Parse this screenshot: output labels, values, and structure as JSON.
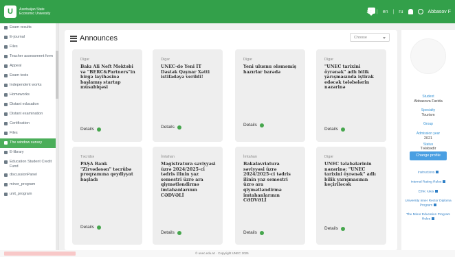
{
  "header": {
    "logo_mark": "U",
    "logo_line1": "Azerbaijan State",
    "logo_line2": "Economic University",
    "lang_1": "az",
    "lang_2": "en",
    "lang_3": "ru",
    "user_short": "Abbasov F"
  },
  "sidebar": {
    "items": [
      {
        "label": "Exam results",
        "icon": "exam-icon"
      },
      {
        "label": "E-journal",
        "icon": "journal-icon"
      },
      {
        "label": "Files",
        "icon": "files-icon"
      },
      {
        "label": "Teacher assessment form",
        "icon": "assessment-icon"
      },
      {
        "label": "Appeal",
        "icon": "appeal-icon"
      },
      {
        "label": "Exam tests",
        "icon": "tests-icon"
      },
      {
        "label": "Independent works",
        "icon": "works-icon"
      },
      {
        "label": "Homeworks",
        "icon": "homework-icon"
      },
      {
        "label": "Distant education",
        "icon": "distant-icon"
      },
      {
        "label": "Distant examination",
        "icon": "examination-icon"
      },
      {
        "label": "Certification",
        "icon": "certificate-icon"
      },
      {
        "label": "Files",
        "icon": "files-icon"
      },
      {
        "label": "The window survey",
        "icon": "survey-icon"
      },
      {
        "label": "E-library",
        "icon": "library-icon"
      },
      {
        "label": "Education Student Credit Fund",
        "icon": "fund-icon"
      },
      {
        "label": "discussionPanel",
        "icon": "discussion-icon"
      },
      {
        "label": "minor_program",
        "icon": "program-icon"
      },
      {
        "label": "unit_program",
        "icon": "unit-icon"
      }
    ],
    "active_index": 12
  },
  "main": {
    "title": "Announces",
    "filter_placeholder": "Choose"
  },
  "cards": [
    {
      "category": "Digər",
      "text": "Bakı Ali Neft Məktəbi və \"BERC&Partners\"in birgə layihəsinə başlamış startap müsabiqəsi",
      "details": "Details"
    },
    {
      "category": "Digər",
      "text": "UNEC-də Yeni İT Dəstək Qaynar Xətti istifadəyə verildi!",
      "details": "Details"
    },
    {
      "category": "Digər",
      "text": "Yeni ulusnu ələməmiş hazırlar barədə",
      "details": "Details"
    },
    {
      "category": "Digər",
      "text": "\"UNEC tarixini öyrənək\" adlı bilik yarışmasında iştirak edəcək tələbələrin nəzərinə",
      "details": "Details"
    },
    {
      "category": "Təcrübə",
      "text": "PAŞA Bank \"Zirvədəsən\" təcrübə proqramına qeydiyyat başladı",
      "details": "Details"
    },
    {
      "category": "İmtahan",
      "text": "Magistratura səviyyəsi üzrə 2024/2025-ci tədris ilinin yaz semestri üzrə ara qiymətləndirmə imtahanlarının CƏDVƏLİ",
      "details": "Details"
    },
    {
      "category": "İmtahan",
      "text": "Bakalavriatura səviyyəsi üzrə 2024/2025-ci tədris ilinin yaz semestri üzrə ara qiymətləndirmə imtahanlarının CƏDVƏLİ",
      "details": "Details"
    },
    {
      "category": "Digər",
      "text": "UNEC tələbələrinin nəzərinə: \"UNEC tarixini öyrənək\" adlı bilik yarışmasının keçiriləcək",
      "details": "Details"
    }
  ],
  "profile": {
    "student_label": "Student",
    "student_name": "Abbasova Farida",
    "specialty_label": "Specialty",
    "specialty_value": "Tourism",
    "group_label": "Group",
    "admission_label": "Admission year",
    "admission_value": "2021",
    "status_label": "Status",
    "status_value": "Tələbədir",
    "change_profile": "Change profile",
    "links": [
      "Instructions",
      "Internal Rating Rules",
      "Ethic rules",
      "University inner Rector Diploma Program",
      "The Minor Education Program Rules"
    ]
  },
  "footer": {
    "text": "© unec.edu.az · Copyright UNEC 2025"
  },
  "colors": {
    "brand_green": "#33a04a",
    "active_green": "#4bae5a",
    "dot_green": "#46a64d",
    "link_blue": "#2f7fc6",
    "button_blue": "#4a9fe2"
  }
}
